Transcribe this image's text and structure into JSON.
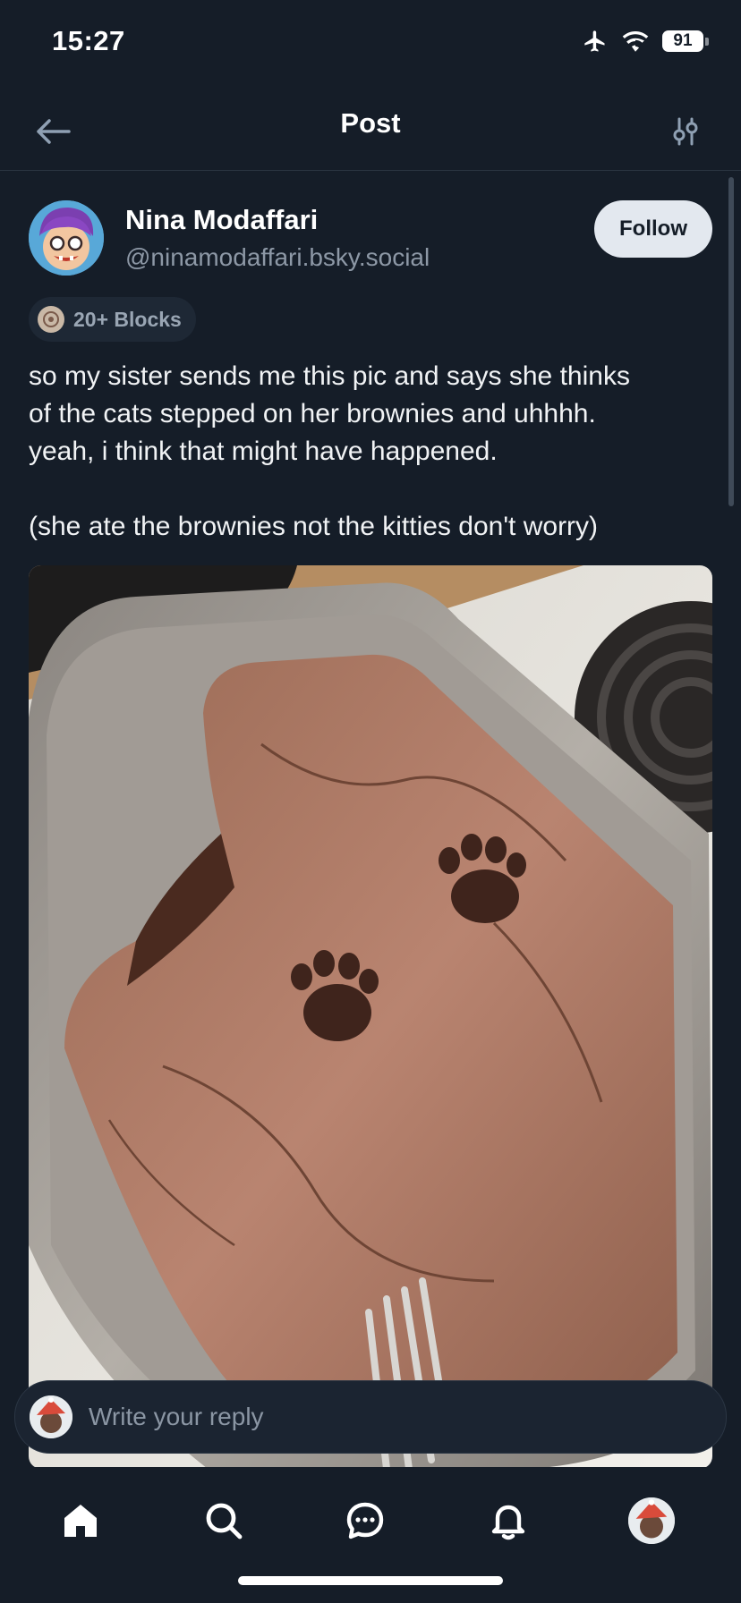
{
  "status_bar": {
    "time": "15:27",
    "battery": "91"
  },
  "header": {
    "title": "Post"
  },
  "post": {
    "author_name": "Nina Modaffari",
    "author_handle": "@ninamodaffari.bsky.social",
    "follow_label": "Follow",
    "badge_label": "20+ Blocks",
    "text_lines": [
      "so my sister sends me this pic and says she thinks",
      "of the cats stepped on her brownies and uhhhh.",
      "yeah, i think that might have happened.",
      "(she ate the brownies not the kitties don't worry)"
    ]
  },
  "reply": {
    "placeholder": "Write your reply"
  },
  "tabs": [
    "home-icon",
    "search-icon",
    "chat-icon",
    "notifications-icon",
    "profile-avatar"
  ],
  "colors": {
    "background": "#151d28",
    "follow_button": "#e3e8ef",
    "muted_text": "#8d98a6"
  }
}
